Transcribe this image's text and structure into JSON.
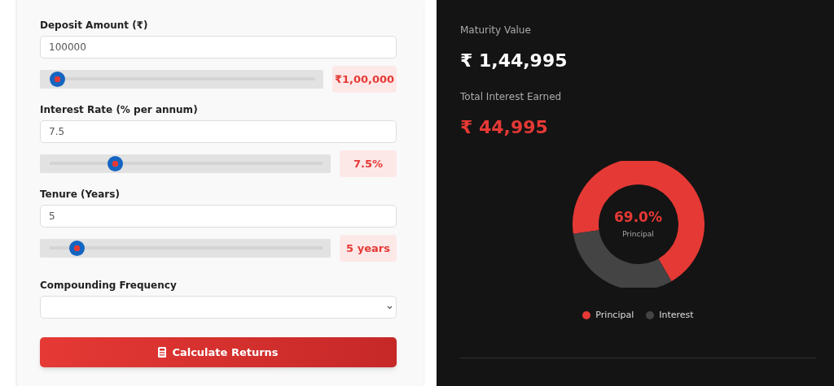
{
  "form": {
    "fields": [
      {
        "label": "Deposit Amount (₹)",
        "value": "100000",
        "level": 0.03,
        "reading": "₹1,00,000"
      },
      {
        "label": "Interest Rate (% per annum)",
        "value": "7.5",
        "level": 0.24,
        "reading": "7.5%"
      },
      {
        "label": "Tenure (Years)",
        "value": "5",
        "level": 0.1,
        "reading": "5 years"
      }
    ],
    "frequency": {
      "label": "Compounding Frequency"
    },
    "button": {
      "label": "Calculate Returns"
    }
  },
  "results": {
    "maturity": {
      "label": "Maturity Value",
      "value": "₹ 1,44,995"
    },
    "interest": {
      "label": "Total Interest Earned",
      "value": "₹ 44,995"
    },
    "center": {
      "value": "69.0%",
      "label": "Principal"
    },
    "chart_data": {
      "type": "donut",
      "series": [
        {
          "values": [
            69.0,
            31.0
          ]
        }
      ]
    },
    "legend": [
      {
        "label": "Principal",
        "color": "#e53935"
      },
      {
        "label": "Interest",
        "color": "#444444"
      }
    ]
  }
}
